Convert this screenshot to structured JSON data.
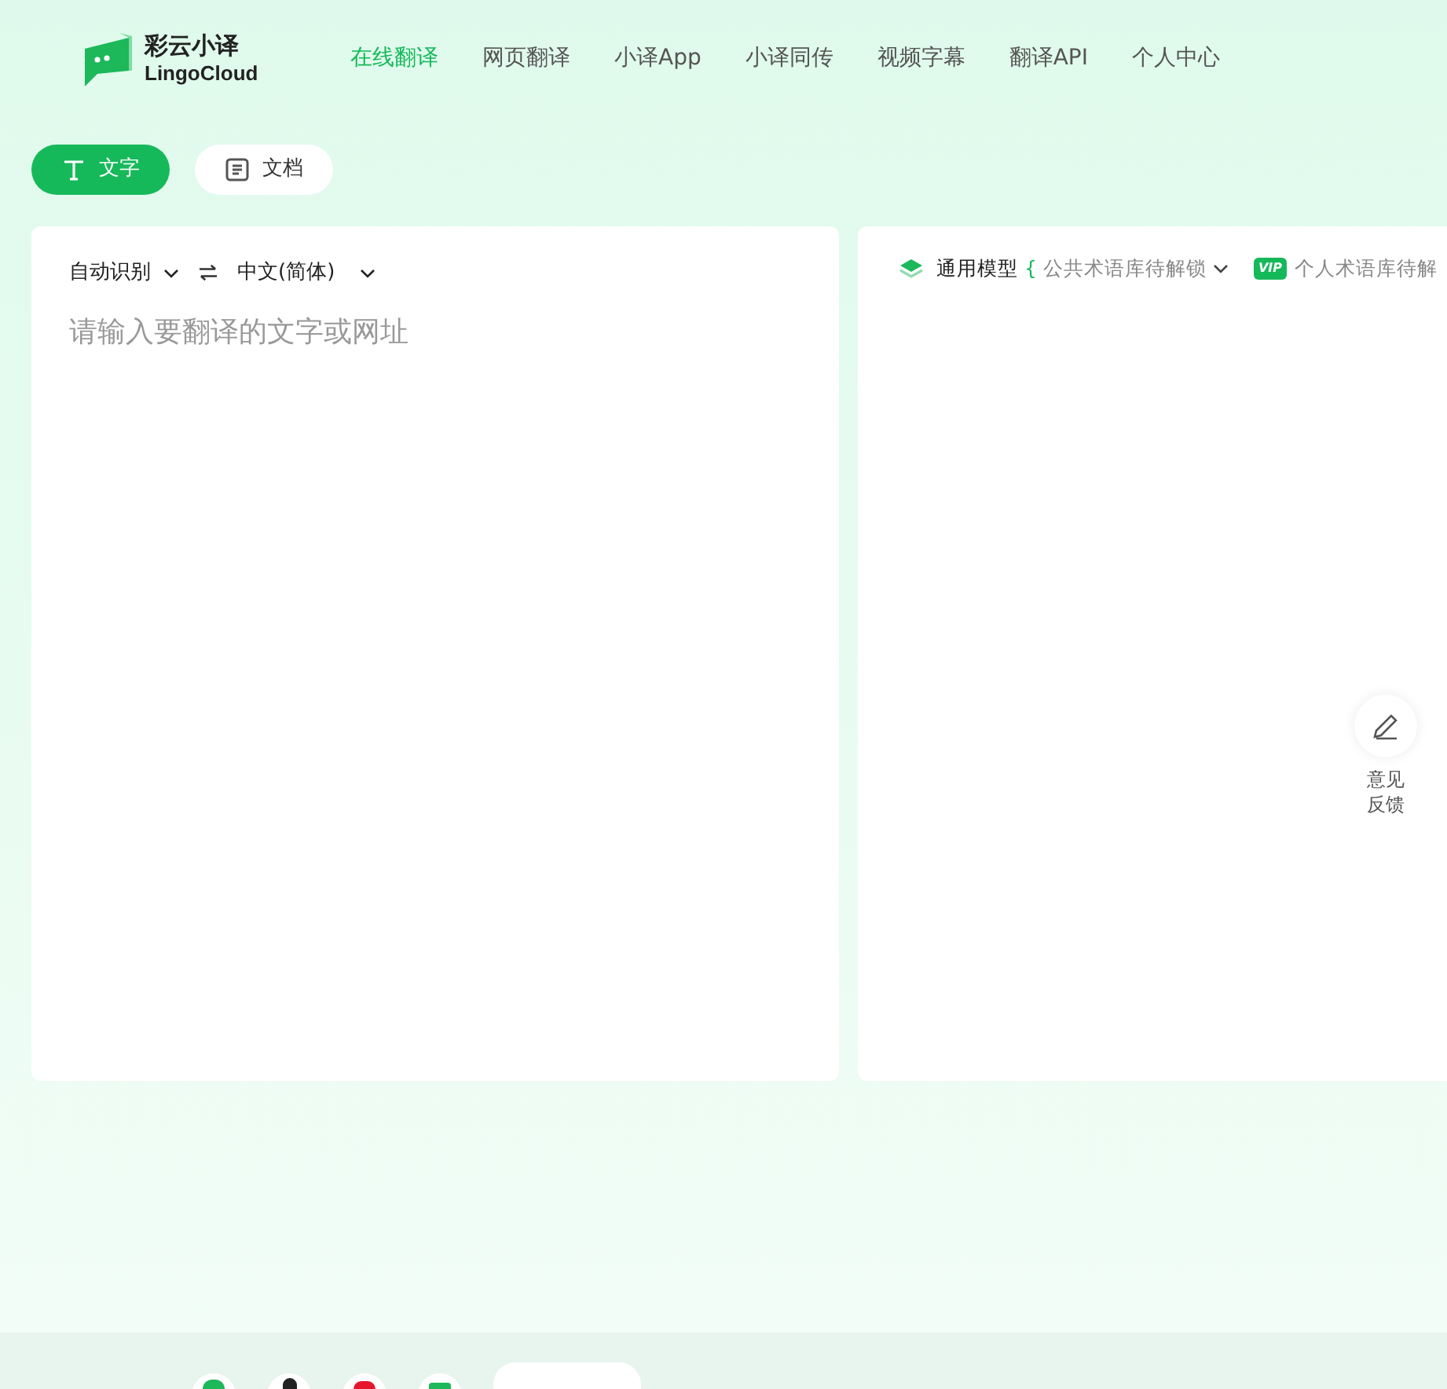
{
  "logo": {
    "name": "彩云小译",
    "subtitle": "LingoCloud"
  },
  "nav": [
    {
      "label": "在线翻译",
      "selected": true
    },
    {
      "label": "网页翻译",
      "selected": false
    },
    {
      "label": "小译App",
      "selected": false
    },
    {
      "label": "小译同传",
      "selected": false
    },
    {
      "label": "视频字幕",
      "selected": false
    },
    {
      "label": "翻译API",
      "selected": false
    },
    {
      "label": "个人中心",
      "selected": false
    }
  ],
  "mode_tabs": [
    {
      "label": "文字",
      "kind": "text",
      "selected": true
    },
    {
      "label": "文档",
      "kind": "document",
      "selected": false
    }
  ],
  "source": {
    "from_language": "自动识别",
    "to_language": "中文(简体)",
    "placeholder": "请输入要翻译的文字或网址"
  },
  "target": {
    "model": "通用模型",
    "bracket": "{",
    "public_glossary": "公共术语库待解锁",
    "vip_badge": "VIP",
    "personal_glossary": "个人术语库待解"
  },
  "feedback": {
    "label": "意见反馈"
  }
}
